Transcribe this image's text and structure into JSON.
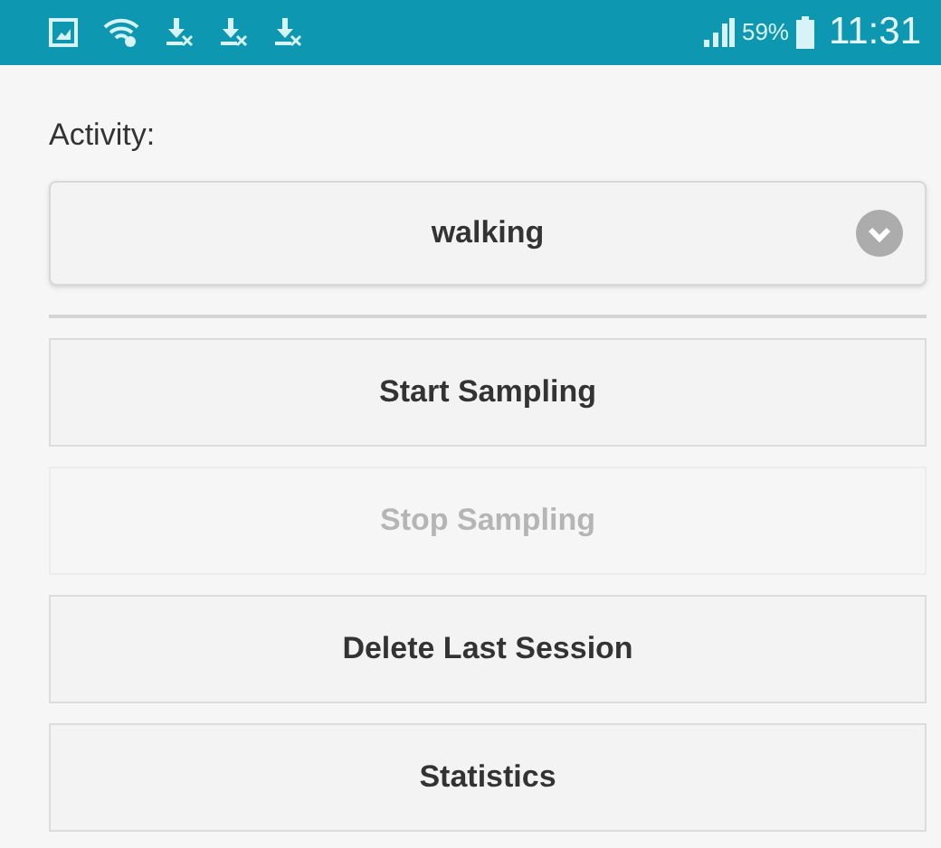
{
  "status_bar": {
    "battery": "59%",
    "time": "11:31"
  },
  "activity": {
    "label": "Activity:",
    "value": "walking"
  },
  "buttons": [
    {
      "label": "Start Sampling",
      "disabled": false
    },
    {
      "label": "Stop Sampling",
      "disabled": true
    },
    {
      "label": "Delete Last Session",
      "disabled": false
    },
    {
      "label": "Statistics",
      "disabled": false
    }
  ]
}
